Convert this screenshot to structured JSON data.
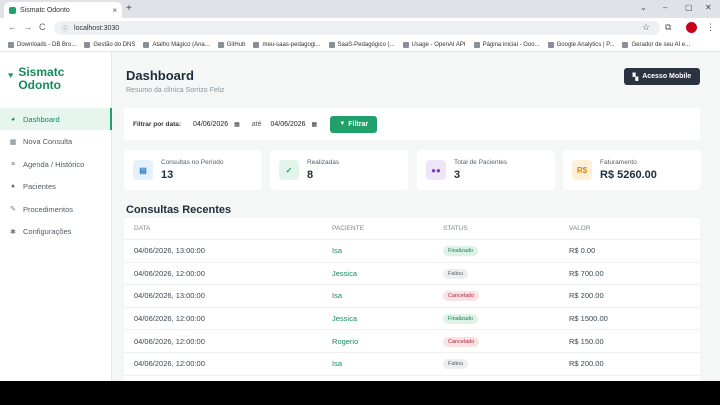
{
  "browser": {
    "tab_title": "Sismatc Odonto",
    "tab_close": "×",
    "new_tab": "+",
    "url": "localhost:3030",
    "window_controls": [
      "⌄",
      "–",
      "▢",
      "✕"
    ],
    "nav_icons": [
      "←",
      "→",
      "C"
    ],
    "bookmarks": [
      "Downloads - DB Bro...",
      "Gestão do DNS",
      "Atalho Mágico (Ana...",
      "GitHub",
      "meu-saas-pedagogi...",
      "SaaS-Pedagógico (...",
      "Usage - OpenAI API",
      "Página inicial - Goo...",
      "Google Analytics | P...",
      "Gerador de seu AI e..."
    ]
  },
  "app": {
    "brand": {
      "name": "Sismatc Odonto",
      "icon": "tooth-icon"
    },
    "sidebar": {
      "items": [
        {
          "label": "Dashboard",
          "icon": "chart-pie-icon",
          "glyph": "◕",
          "active": true
        },
        {
          "label": "Nova Consulta",
          "icon": "calendar-plus-icon",
          "glyph": "▦",
          "active": false
        },
        {
          "label": "Agenda / Histórico",
          "icon": "list-icon",
          "glyph": "≡",
          "active": false
        },
        {
          "label": "Pacientes",
          "icon": "users-icon",
          "glyph": "●",
          "active": false
        },
        {
          "label": "Procedimentos",
          "icon": "syringe-icon",
          "glyph": "✎",
          "active": false
        },
        {
          "label": "Configurações",
          "icon": "gear-icon",
          "glyph": "✱",
          "active": false
        }
      ]
    },
    "header": {
      "title": "Dashboard",
      "subtitle": "Resumo da clínica Sorrizo Feliz",
      "mobile_button": "Acesso Mobile"
    },
    "filter": {
      "label": "Filtrar por data:",
      "from": "04/06/2026",
      "separator": "até",
      "to": "04/06/2026",
      "button": "Filtrar"
    },
    "stats": [
      {
        "label": "Consultas no Período",
        "value": "13",
        "icon": "calendar-icon",
        "glyph": "▤",
        "color": "#2f7ec8",
        "bg": "#e4f0fb"
      },
      {
        "label": "Realizadas",
        "value": "8",
        "icon": "check-circle-icon",
        "glyph": "✓",
        "color": "#22a06b",
        "bg": "#e2f5ea"
      },
      {
        "label": "Total de Pacientes",
        "value": "3",
        "icon": "users-icon",
        "glyph": "●●",
        "color": "#7b3fbf",
        "bg": "#efe5f8"
      },
      {
        "label": "Faturamento",
        "value": "R$ 5260.00",
        "icon": "money-icon",
        "glyph": "R$",
        "color": "#d18a15",
        "bg": "#fcf0d9"
      }
    ],
    "recent": {
      "title": "Consultas Recentes",
      "columns": [
        "DATA",
        "PACIENTE",
        "STATUS",
        "VALOR"
      ],
      "rows": [
        {
          "date": "04/06/2026, 13:00:00",
          "patient": "Isa",
          "status": "Finalizado",
          "status_kind": "fin",
          "value": "R$ 0.00"
        },
        {
          "date": "04/06/2026, 12:00:00",
          "patient": "Jessica",
          "status": "Faltou",
          "status_kind": "fal",
          "value": "R$ 700.00"
        },
        {
          "date": "04/06/2026, 13:00:00",
          "patient": "Isa",
          "status": "Cancelado",
          "status_kind": "can",
          "value": "R$ 200.00"
        },
        {
          "date": "04/06/2026, 12:00:00",
          "patient": "Jessica",
          "status": "Finalizado",
          "status_kind": "fin",
          "value": "R$ 1500.00"
        },
        {
          "date": "04/06/2026, 12:00:00",
          "patient": "Rogerio",
          "status": "Cancelado",
          "status_kind": "can",
          "value": "R$ 150.00"
        },
        {
          "date": "04/06/2026, 12:00:00",
          "patient": "Isa",
          "status": "Faltou",
          "status_kind": "fal",
          "value": "R$ 200.00"
        }
      ]
    }
  }
}
